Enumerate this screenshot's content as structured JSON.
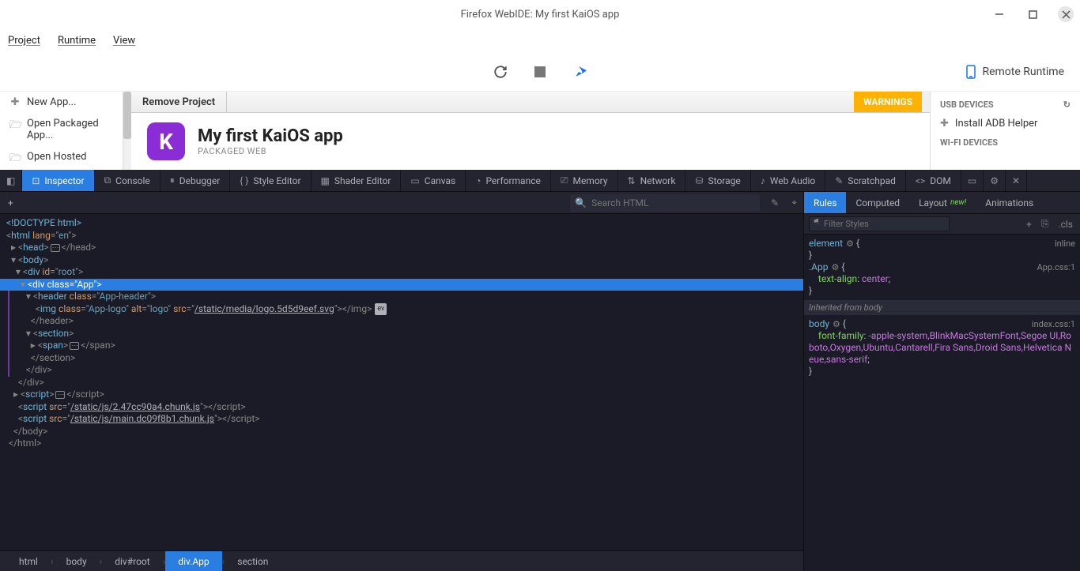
{
  "window": {
    "title": "Firefox WebIDE: My first KaiOS app"
  },
  "menubar": {
    "items": [
      "Project",
      "Runtime",
      "View"
    ]
  },
  "remote": {
    "label": "Remote Runtime"
  },
  "leftPanel": {
    "items": [
      {
        "icon": "plus-circle",
        "label": "New App..."
      },
      {
        "icon": "folder",
        "label": "Open Packaged App..."
      },
      {
        "icon": "folder",
        "label": "Open Hosted"
      }
    ]
  },
  "projectBar": {
    "remove": "Remove Project",
    "warnings": "WARNINGS"
  },
  "project": {
    "title": "My first KaiOS app",
    "subtitle": "PACKAGED WEB",
    "iconLetter": "K"
  },
  "rightPanel": {
    "usbHeader": "USB DEVICES",
    "installAdb": "Install ADB Helper",
    "wifiHeader": "WI-FI DEVICES"
  },
  "devtoolsTabs": {
    "inspector": "Inspector",
    "console": "Console",
    "debugger": "Debugger",
    "styleEditor": "Style Editor",
    "shaderEditor": "Shader Editor",
    "canvas": "Canvas",
    "performance": "Performance",
    "memory": "Memory",
    "network": "Network",
    "storage": "Storage",
    "webAudio": "Web Audio",
    "scratchpad": "Scratchpad",
    "dom": "DOM"
  },
  "search": {
    "placeholder": "Search HTML"
  },
  "dom": {
    "doctype": "<!DOCTYPE html>",
    "htmlOpen": "html",
    "htmlLang": "en",
    "head": "head",
    "body": "body",
    "divRoot": {
      "tag": "div",
      "idAttr": "id",
      "idVal": "root"
    },
    "divApp": {
      "tag": "div",
      "classAttr": "class",
      "classVal": "App"
    },
    "header": {
      "tag": "header",
      "classAttr": "class",
      "classVal": "App-header"
    },
    "img": {
      "tag": "img",
      "classAttr": "class",
      "classVal": "App-logo",
      "altAttr": "alt",
      "altVal": "logo",
      "srcAttr": "src",
      "srcVal": "/static/media/logo.5d5d9eef.svg"
    },
    "section": "section",
    "span": "span",
    "script": "script",
    "scriptSrc1": "/static/js/2.47cc90a4.chunk.js",
    "scriptSrc2": "/static/js/main.dc09f8b1.chunk.js",
    "evBadge": "ev"
  },
  "breadcrumb": {
    "items": [
      "html",
      "body",
      "div#root",
      "div.App",
      "section"
    ],
    "activeIndex": 3
  },
  "stylesTabs": {
    "rules": "Rules",
    "computed": "Computed",
    "layout": "Layout",
    "new": "new!",
    "animations": "Animations"
  },
  "filter": {
    "placeholder": "Filter Styles",
    "cls": ".cls"
  },
  "css": {
    "element": "element",
    "inline": "inline",
    "appSel": ".App",
    "appSrc": "App.css:1",
    "textAlignProp": "text-align",
    "textAlignVal": "center",
    "inheritedLabel": "Inherited from body",
    "bodySel": "body",
    "bodySrc": "index.css:1",
    "fontFamilyProp": "font-family",
    "fontFamilyVal": "-apple-system,BlinkMacSystemFont,Segoe UI,Roboto,Oxygen,Ubuntu,Cantarell,Fira Sans,Droid Sans,Helvetica Neue,sans-serif"
  }
}
